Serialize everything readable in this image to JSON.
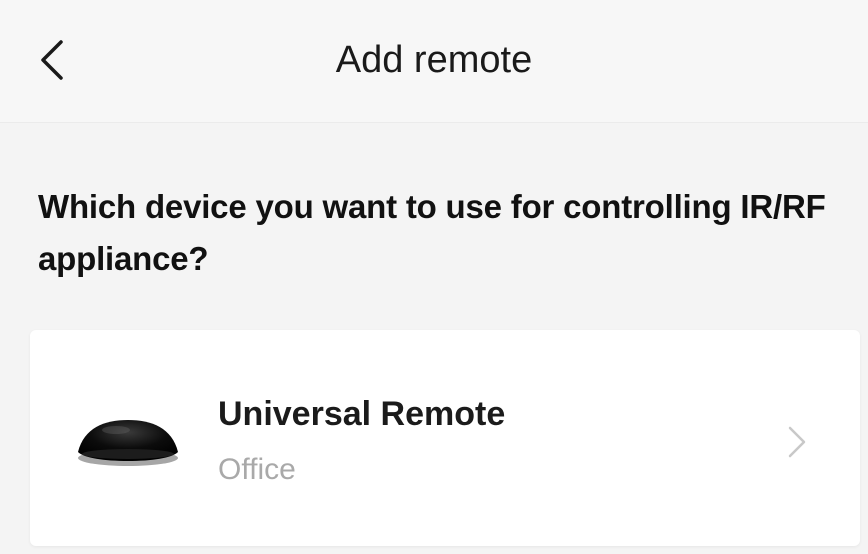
{
  "header": {
    "title": "Add remote",
    "back_icon": "chevron-left-icon"
  },
  "prompt": "Which device you want to use for controlling IR/RF appliance?",
  "devices": [
    {
      "name": "Universal Remote",
      "room": "Office",
      "image_icon": "ir-blaster-hub-icon",
      "arrow_icon": "chevron-right-icon"
    }
  ],
  "colors": {
    "background": "#f4f4f4",
    "header_background": "#f7f7f7",
    "card_background": "#ffffff",
    "primary_text": "#111111",
    "secondary_text": "#a9a9a9",
    "chevron": "#c8c8c8"
  }
}
